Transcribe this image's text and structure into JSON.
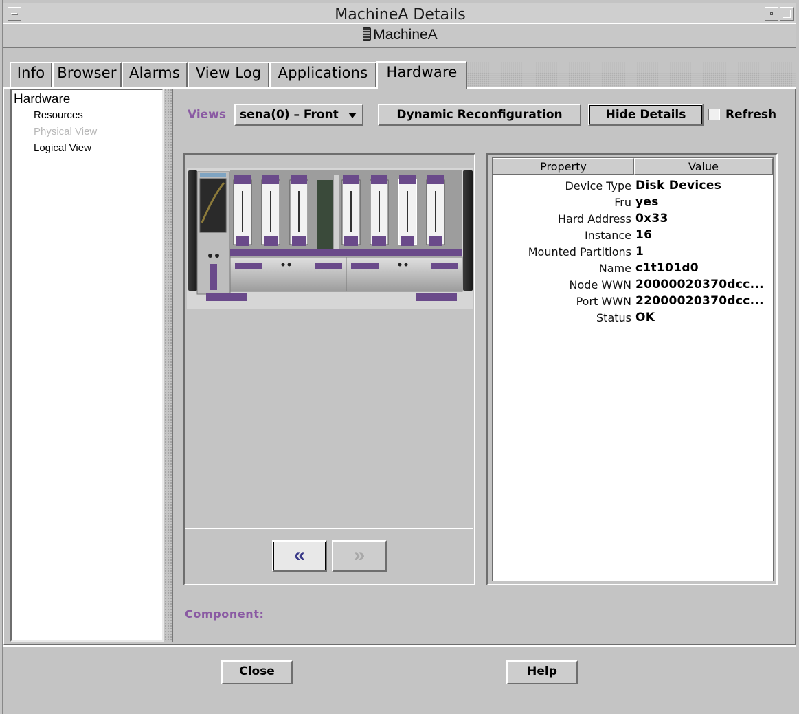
{
  "window": {
    "title": "MachineA Details",
    "host_name": "MachineA"
  },
  "tabs": [
    {
      "label": "Info",
      "active": false
    },
    {
      "label": "Browser",
      "active": false
    },
    {
      "label": "Alarms",
      "active": false
    },
    {
      "label": "View Log",
      "active": false
    },
    {
      "label": "Applications",
      "active": false
    },
    {
      "label": "Hardware",
      "active": true
    }
  ],
  "tree": {
    "root": "Hardware",
    "items": [
      {
        "label": "Resources",
        "enabled": true
      },
      {
        "label": "Physical View",
        "enabled": false
      },
      {
        "label": "Logical View",
        "enabled": true
      }
    ]
  },
  "toolbar": {
    "views_label": "Views",
    "views_selected": "sena(0) – Front",
    "dynamic_reconfig_label": "Dynamic Reconfiguration",
    "hide_details_label": "Hide Details",
    "refresh_label": "Refresh",
    "refresh_checked": false
  },
  "property_table": {
    "headers": [
      "Property",
      "Value"
    ],
    "rows": [
      {
        "property": "Device Type",
        "value": "Disk Devices"
      },
      {
        "property": "Fru",
        "value": "yes"
      },
      {
        "property": "Hard Address",
        "value": "0x33"
      },
      {
        "property": "Instance",
        "value": "16"
      },
      {
        "property": "Mounted Partitions",
        "value": "1"
      },
      {
        "property": "Name",
        "value": "c1t101d0"
      },
      {
        "property": "Node WWN",
        "value": "20000020370dcc..."
      },
      {
        "property": "Port WWN",
        "value": "22000020370dcc..."
      },
      {
        "property": "Status",
        "value": "OK"
      }
    ]
  },
  "component_label": "Component:",
  "footer": {
    "close_label": "Close",
    "help_label": "Help"
  },
  "colors": {
    "accent_label": "#8a5aa3",
    "chassis_purple": "#6a4a8a"
  }
}
